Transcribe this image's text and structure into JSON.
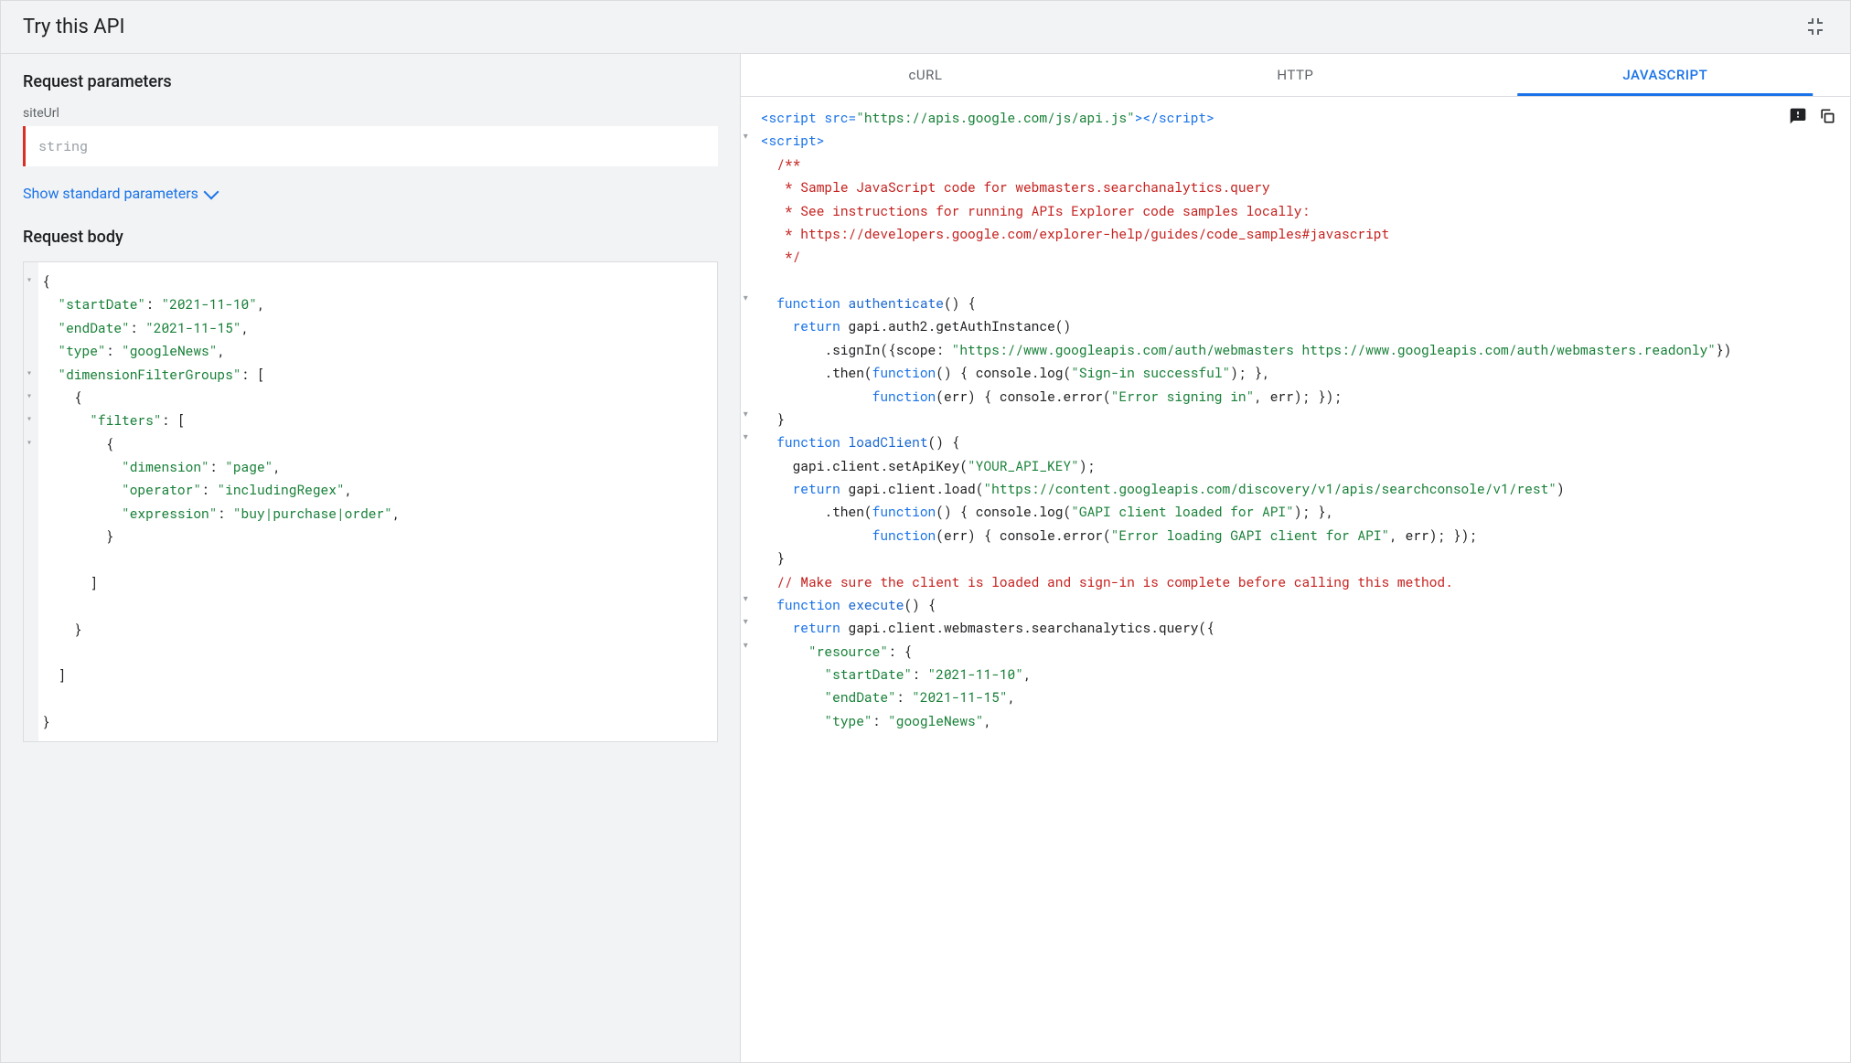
{
  "header": {
    "title": "Try this API"
  },
  "left": {
    "params_title": "Request parameters",
    "param_label": "siteUrl",
    "param_placeholder": "string",
    "show_std": "Show standard parameters",
    "body_title": "Request body",
    "json": "{\n  \"startDate\": \"2021-11-10\",\n  \"endDate\": \"2021-11-15\",\n  \"type\": \"googleNews\",\n  \"dimensionFilterGroups\": [\n    {\n      \"filters\": [\n        {\n          \"dimension\": \"page\",\n          \"operator\": \"includingRegex\",\n          \"expression\": \"buy|purchase|order\",\n        }\n\n      ]\n\n    }\n\n  ]\n\n}"
  },
  "tabs": {
    "curl": "cURL",
    "http": "HTTP",
    "js": "JAVASCRIPT"
  },
  "code": {
    "line1_open": "<script src=",
    "line1_src": "\"https://apis.google.com/js/api.js\"",
    "line1_close": "></script>",
    "line2": "<script>",
    "c1": "/**",
    "c2": " * Sample JavaScript code for webmasters.searchanalytics.query",
    "c3": " * See instructions for running APIs Explorer code samples locally:",
    "c4": " * https://developers.google.com/explorer-help/guides/code_samples#javascript",
    "c5": " */",
    "kw_function": "function",
    "kw_return": "return",
    "fn_auth": "authenticate",
    "auth_body1": " gapi.auth2.getAuthInstance()",
    "auth_scope_pre": "        .signIn({scope: ",
    "auth_scope": "\"https://www.googleapis.com/auth/webmasters https://www.googleapis.com/auth/webmasters.readonly\"",
    "auth_then": "        .then(",
    "auth_log": "() { console.log(",
    "auth_log_str": "\"Sign-in successful\"",
    "auth_log_end": "); },",
    "auth_err_pre": "              ",
    "auth_err_sig": "(err) { console.error(",
    "auth_err_str": "\"Error signing in\"",
    "auth_err_end": ", err); });",
    "fn_load": "loadClient",
    "load_key_pre": "    gapi.client.setApiKey(",
    "load_key": "\"YOUR_API_KEY\"",
    "load_key_end": ");",
    "load_ret": " gapi.client.load(",
    "load_url": "\"https://content.googleapis.com/discovery/v1/apis/searchconsole/v1/rest\"",
    "load_log_str": "\"GAPI client loaded for API\"",
    "load_err_str": "\"Error loading GAPI client for API\"",
    "comment_exec": "// Make sure the client is loaded and sign-in is complete before calling this method.",
    "fn_exec": "execute",
    "exec_ret": " gapi.client.webmasters.searchanalytics.query({",
    "res_key": "\"resource\"",
    "sd_key": "\"startDate\"",
    "sd_val": "\"2021-11-10\"",
    "ed_key": "\"endDate\"",
    "ed_val": "\"2021-11-15\"",
    "ty_key": "\"type\"",
    "ty_val": "\"googleNews\""
  }
}
